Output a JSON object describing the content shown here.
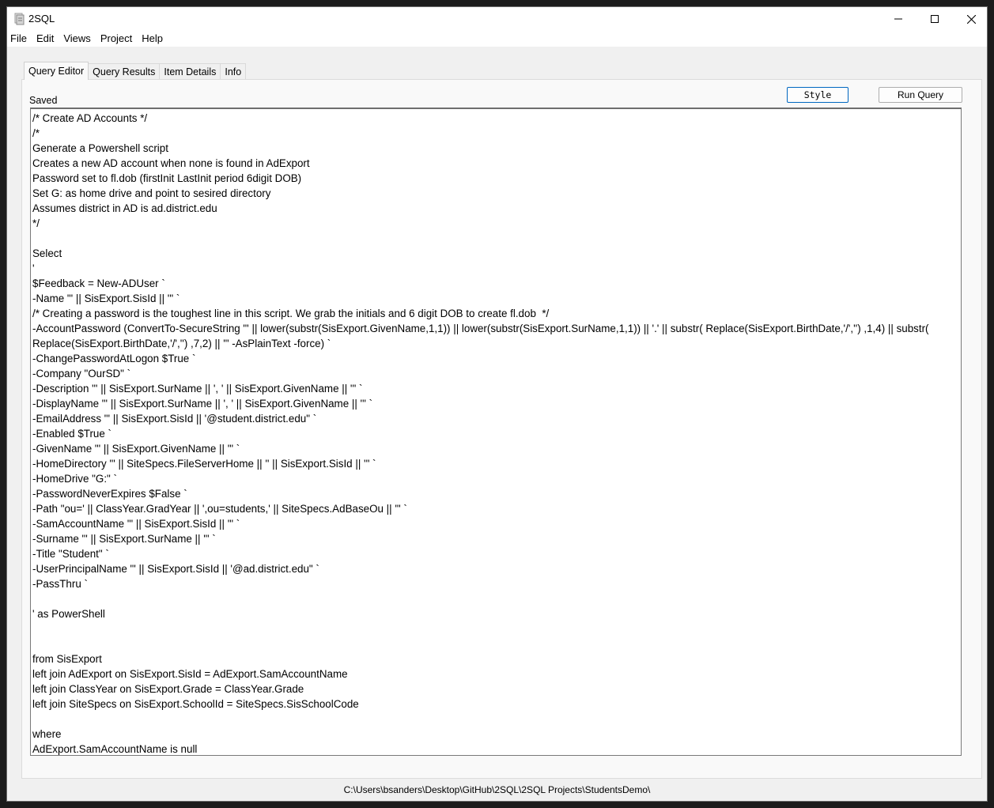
{
  "window": {
    "title": "2SQL",
    "controls": {
      "minimize": "minimize-icon",
      "maximize": "maximize-icon",
      "close": "close-icon"
    }
  },
  "menu": [
    "File",
    "Edit",
    "Views",
    "Project",
    "Help"
  ],
  "tabs": [
    "Query Editor",
    "Query Results",
    "Item Details",
    "Info"
  ],
  "toolbar": {
    "status": "Saved",
    "style_label": "Style",
    "run_label": "Run Query"
  },
  "editor": {
    "lines": [
      "/* Create AD Accounts */",
      "/*",
      "Generate a Powershell script",
      "Creates a new AD account when none is found in AdExport",
      "Password set to fl.dob (firstInit LastInit period 6digit DOB)",
      "Set G: as home drive and point to sesired directory",
      "Assumes district in AD is ad.district.edu",
      "*/",
      "",
      "Select",
      "'",
      "$Feedback = New-ADUser `",
      "-Name \"' || SisExport.SisId || '\" `",
      "/* Creating a password is the toughest line in this script. We grab the initials and 6 digit DOB to create fl.dob  */",
      "-AccountPassword (ConvertTo-SecureString \"' || lower(substr(SisExport.GivenName,1,1)) || lower(substr(SisExport.SurName,1,1)) || '.' || substr( Replace(SisExport.BirthDate,'/','') ,1,4) || substr(",
      "Replace(SisExport.BirthDate,'/','') ,7,2) || '\" -AsPlainText -force) `",
      "-ChangePasswordAtLogon $True `",
      "-Company \"OurSD\" `",
      "-Description \"' || SisExport.SurName || ', ' || SisExport.GivenName || '\" `",
      "-DisplayName \"' || SisExport.SurName || ', ' || SisExport.GivenName || '\" `",
      "-EmailAddress \"' || SisExport.SisId || '@student.district.edu\" `",
      "-Enabled $True `",
      "-GivenName \"' || SisExport.GivenName || '\" `",
      "-HomeDirectory \"' || SiteSpecs.FileServerHome || '' || SisExport.SisId || '\" `",
      "-HomeDrive \"G:\" `",
      "-PasswordNeverExpires $False `",
      "-Path \"ou=' || ClassYear.GradYear || ',ou=students,' || SiteSpecs.AdBaseOu || '\" `",
      "-SamAccountName \"' || SisExport.SisId || '\" `",
      "-Surname \"' || SisExport.SurName || '\" `",
      "-Title \"Student\" `",
      "-UserPrincipalName \"' || SisExport.SisId || '@ad.district.edu\" `",
      "-PassThru `",
      "",
      "' as PowerShell",
      "",
      "",
      "from SisExport",
      "left join AdExport on SisExport.SisId = AdExport.SamAccountName",
      "left join ClassYear on SisExport.Grade = ClassYear.Grade",
      "left join SiteSpecs on SisExport.SchoolId = SiteSpecs.SisSchoolCode",
      "",
      "where",
      "AdExport.SamAccountName is null"
    ]
  },
  "statusbar": {
    "project_path": "C:\\Users\\bsanders\\Desktop\\GitHub\\2SQL\\2SQL Projects\\StudentsDemo\\"
  }
}
